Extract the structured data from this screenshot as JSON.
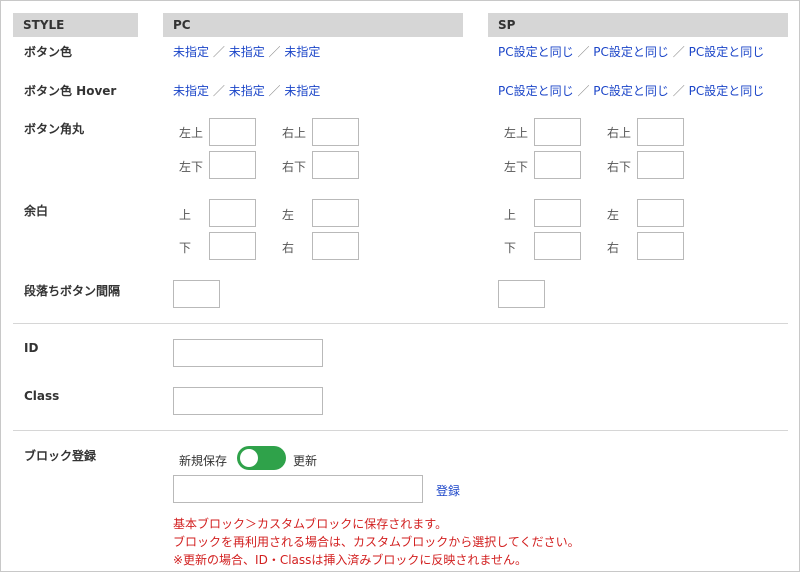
{
  "headers": {
    "style": "STYLE",
    "pc": "PC",
    "sp": "SP"
  },
  "rows": {
    "button_color": "ボタン色",
    "button_color_hover": "ボタン色 Hover",
    "button_radius": "ボタン角丸",
    "padding": "余白",
    "paragraph_gap": "段落ちボタン間隔",
    "id": "ID",
    "class": "Class",
    "block_register": "ブロック登録"
  },
  "pc_links": {
    "item": "未指定",
    "sep": "／"
  },
  "sp_links": {
    "item": "PC設定と同じ",
    "sep": "／"
  },
  "corners": {
    "top_left": "左上",
    "top_right": "右上",
    "bottom_left": "左下",
    "bottom_right": "右下"
  },
  "sides": {
    "top": "上",
    "left": "左",
    "bottom": "下",
    "right": "右"
  },
  "block": {
    "new_save": "新規保存",
    "update": "更新",
    "toggle_on": true,
    "register": "登録",
    "notes": [
      "基本ブロック＞カスタムブロックに保存されます。",
      "ブロックを再利用される場合は、カスタムブロックから選択してください。",
      "※更新の場合、ID・Classは挿入済みブロックに反映されません。"
    ]
  },
  "colors": {
    "link": "#1b45c8",
    "toggle": "#2fa24a",
    "note": "#d21f1f",
    "header_bg": "#d6d6d6"
  }
}
